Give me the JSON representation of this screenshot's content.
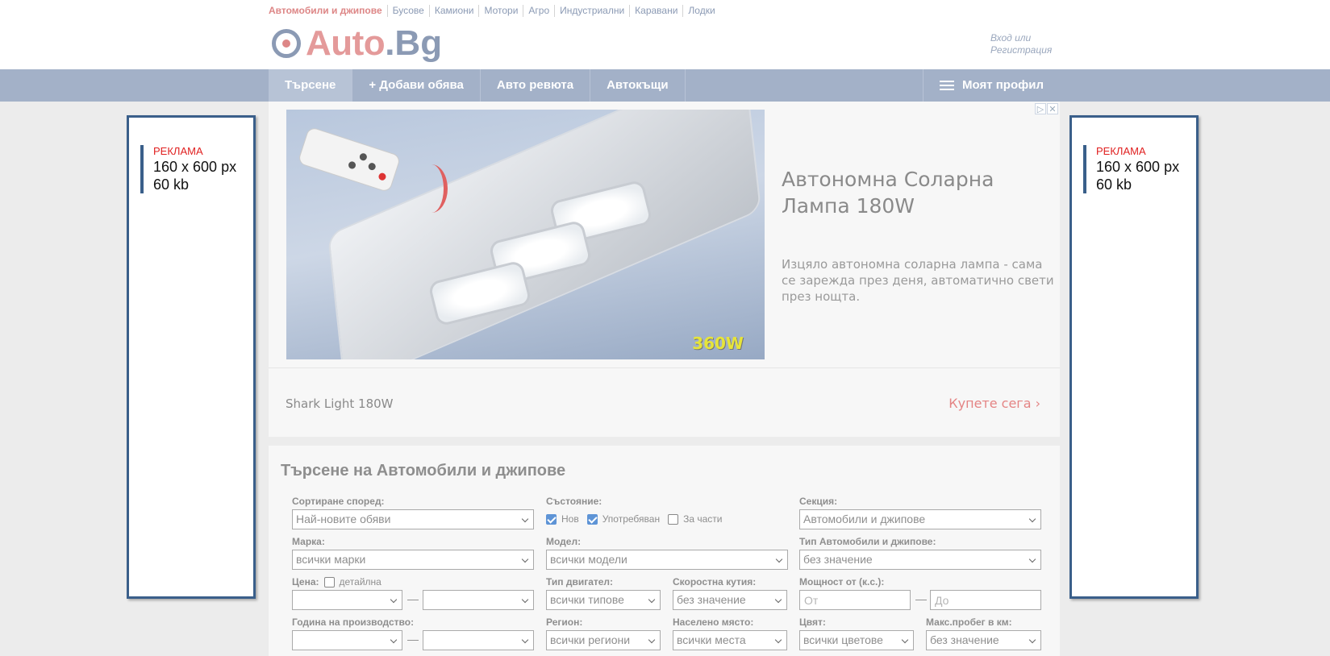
{
  "categories": [
    "Автомобили и джипове",
    "Бусове",
    "Камиони",
    "Мотори",
    "Агро",
    "Индустриални",
    "Каравани",
    "Лодки"
  ],
  "logo": {
    "auto": "Auto",
    "dot": ".",
    "bg": "Bg"
  },
  "login": {
    "line1": "Вход или",
    "line2": "Регистрация"
  },
  "nav": {
    "search": "Търсене",
    "add": "+ Добави обява",
    "review": "Авто ревюта",
    "parts": "Автокъщи",
    "profile": "Моят профил"
  },
  "side_ad": {
    "label": "РЕКЛАМА",
    "size": "160 x 600 px",
    "weight": "60 kb"
  },
  "ad": {
    "close_info": "▷",
    "close_x": "✕",
    "watt": "360W",
    "title": "Автономна Соларна Лампа 180W",
    "description": "Изцяло автономна соларна лампа - сама се зарежда през деня, автоматично свети през нощта.",
    "brand": "Shark Light 180W",
    "cta": "Купете сега ›"
  },
  "search": {
    "title": "Търсене на Автомобили и джипове",
    "sort_label": "Сортиране според:",
    "sort_value": "Най-новите обяви",
    "state_label": "Състояние:",
    "state_new": "Нов",
    "state_used": "Употребяван",
    "state_parts": "За части",
    "section_label": "Секция:",
    "section_value": "Автомобили и джипове",
    "make_label": "Марка:",
    "make_value": "всички марки",
    "model_label": "Модел:",
    "model_value": "всички модели",
    "type_label": "Тип Автомобили и джипове:",
    "type_value": "без значение",
    "price_label": "Цена:",
    "price_detail": "детайлна",
    "engine_label": "Тип двигател:",
    "engine_value": "всички типове",
    "gear_label": "Скоростна кутия:",
    "gear_value": "без значение",
    "power_label": "Мощност от (к.с.):",
    "power_from": "От",
    "power_to": "До",
    "year_label": "Година на производство:",
    "region_label": "Регион:",
    "region_value": "всички региони",
    "city_label": "Населено място:",
    "city_value": "всички места",
    "color_label": "Цвят:",
    "color_value": "всички цветове",
    "mileage_label": "Макс.пробег в км:",
    "mileage_value": "без значение",
    "dash": "—"
  }
}
